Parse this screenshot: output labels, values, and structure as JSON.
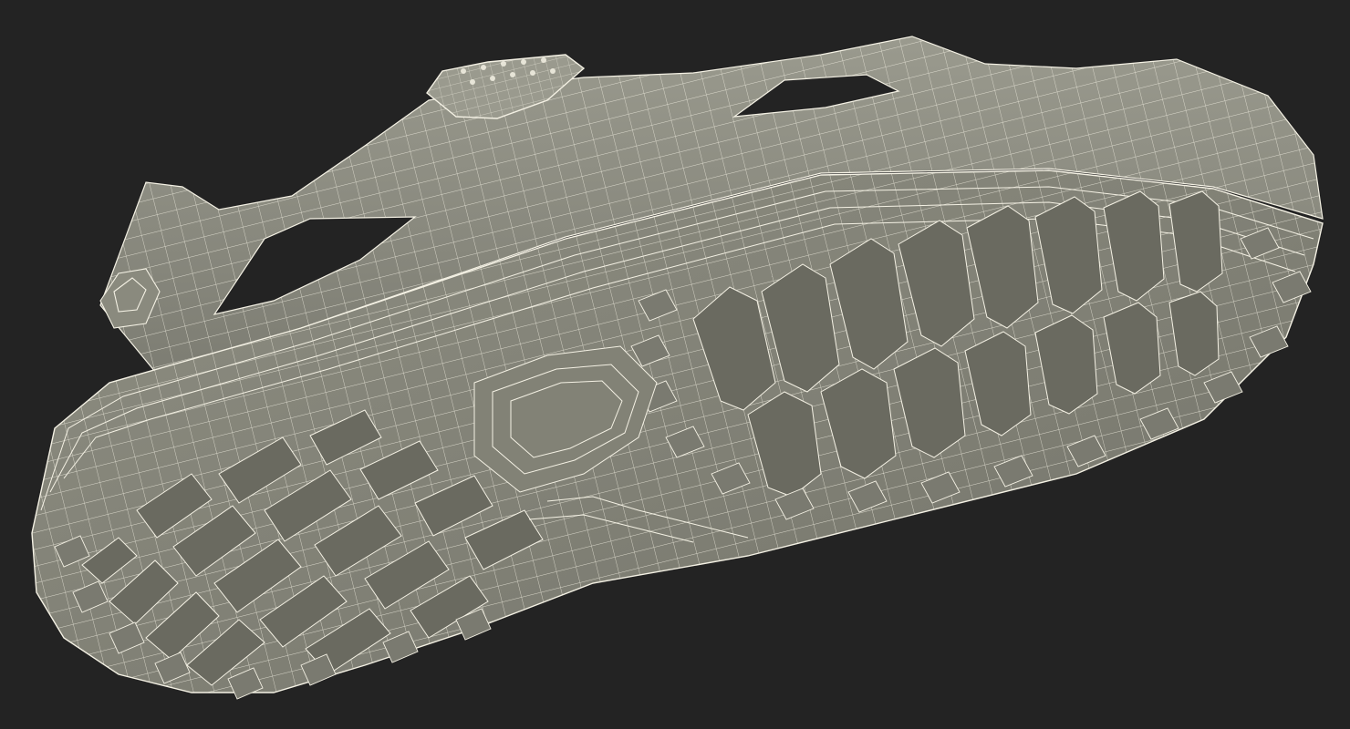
{
  "scene": {
    "subject": "clog-shoe-sole-wireframe",
    "colors": {
      "background": "#232323",
      "surface": "#86867a",
      "surface_light": "#9a9a8c",
      "surface_dark": "#5e5e54",
      "wire": "#f4f1e4"
    }
  }
}
